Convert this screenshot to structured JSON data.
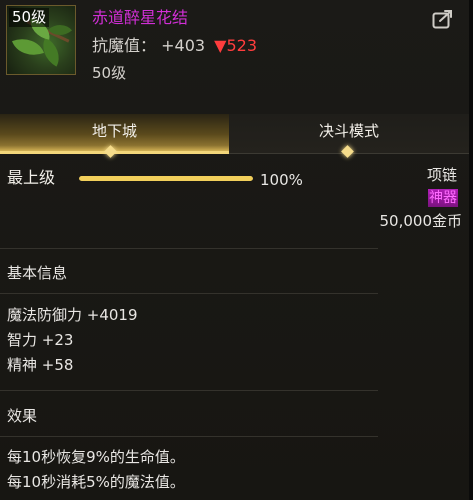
{
  "item": {
    "icon": "green-leaf-necklace-icon",
    "level_badge": "50级",
    "name": "赤道醉星花结",
    "name_color": "#d12fd6",
    "magic_resist_label": "抗魔值：",
    "magic_resist_value": "+403",
    "magic_resist_drop_arrow": "▼",
    "magic_resist_drop_value": "523",
    "required_level": "50级"
  },
  "tabs": [
    {
      "label": "地下城",
      "active": true
    },
    {
      "label": "决斗模式",
      "active": false
    }
  ],
  "upgrade": {
    "grade_label": "最上级",
    "progress": 1.0,
    "percent_text": "100%"
  },
  "slot": {
    "type": "项链",
    "rarity_tag": "神器",
    "rarity_color": "#b01eb7",
    "price": "50,000金币"
  },
  "basic_info": {
    "title": "基本信息",
    "stats": [
      "魔法防御力 +4019",
      "智力 +23",
      "精神 +58"
    ]
  },
  "effects": {
    "title": "效果",
    "lines": [
      "每10秒恢复9%的生命值。",
      "每10秒消耗5%的魔法值。"
    ]
  },
  "share_icon": "share-export-icon"
}
